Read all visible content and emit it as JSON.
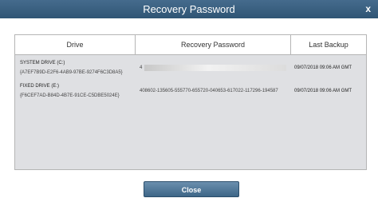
{
  "dialog": {
    "title": "Recovery Password",
    "close_icon_glyph": "x"
  },
  "table": {
    "columns": [
      "Drive",
      "Recovery Password",
      "Last Backup"
    ],
    "rows": [
      {
        "drive": "SYSTEM DRIVE (C:)",
        "drive_id": "{A7EF7B9D-E2F6-4AB9-97BE-9274F6C3D8A5}",
        "password": "4",
        "last_backup": "09/07/2018 09:06 AM   GMT"
      },
      {
        "drive": "FIXED DRIVE (E:)",
        "drive_id": "{F6CEF7AD-B84D-4B7E-91CE-C5DBE5024E}",
        "password": "408602-135605-555770-655720-040653-617022-117296-194587",
        "last_backup": "09/07/2018 09:06 AM   GMT"
      }
    ]
  },
  "footer": {
    "close_label": "Close"
  },
  "colors": {
    "titlebar": "#3a6080",
    "button": "#4f7598",
    "body_fill": "#dfe0e3",
    "border": "#b5b5b5"
  }
}
